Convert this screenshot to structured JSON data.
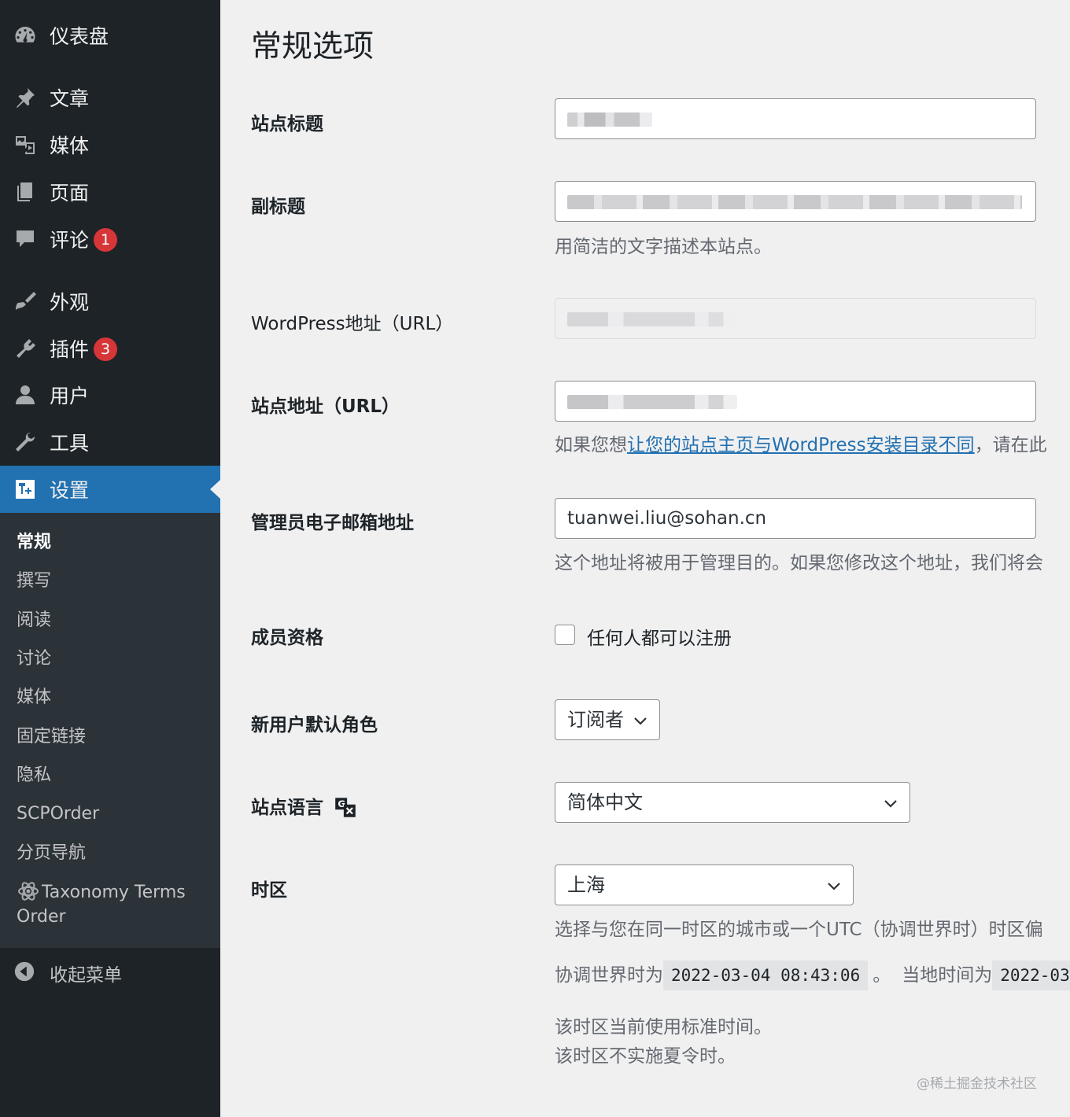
{
  "sidebar": {
    "items": [
      {
        "label": "仪表盘",
        "icon": "dashboard-icon"
      },
      {
        "label": "文章",
        "icon": "pin-icon"
      },
      {
        "label": "媒体",
        "icon": "media-icon"
      },
      {
        "label": "页面",
        "icon": "page-icon"
      },
      {
        "label": "评论",
        "icon": "comment-icon",
        "badge": "1"
      },
      {
        "label": "外观",
        "icon": "appearance-icon"
      },
      {
        "label": "插件",
        "icon": "plugin-icon",
        "badge": "3"
      },
      {
        "label": "用户",
        "icon": "users-icon"
      },
      {
        "label": "工具",
        "icon": "tools-icon"
      },
      {
        "label": "设置",
        "icon": "settings-icon",
        "active": true
      }
    ],
    "submenu": [
      {
        "label": "常规",
        "current": true
      },
      {
        "label": "撰写"
      },
      {
        "label": "阅读"
      },
      {
        "label": "讨论"
      },
      {
        "label": "媒体"
      },
      {
        "label": "固定链接"
      },
      {
        "label": "隐私"
      },
      {
        "label": "SCPOrder"
      },
      {
        "label": "分页导航"
      },
      {
        "label": "Taxonomy Terms Order",
        "icon": "atom-icon"
      }
    ],
    "collapse_label": "收起菜单"
  },
  "page": {
    "title": "常规选项",
    "site_title": {
      "label": "站点标题"
    },
    "tagline": {
      "label": "副标题",
      "description": "用简洁的文字描述本站点。"
    },
    "wp_url": {
      "label": "WordPress地址（URL）"
    },
    "site_url": {
      "label": "站点地址（URL）",
      "desc_prefix": "如果您想",
      "desc_link": "让您的站点主页与WordPress安装目录不同",
      "desc_suffix": "，请在此"
    },
    "admin_email": {
      "label": "管理员电子邮箱地址",
      "value": "tuanwei.liu@sohan.cn",
      "description": "这个地址将被用于管理目的。如果您修改这个地址，我们将会"
    },
    "membership": {
      "label": "成员资格",
      "checkbox_label": "任何人都可以注册",
      "checked": false
    },
    "default_role": {
      "label": "新用户默认角色",
      "value": "订阅者"
    },
    "site_language": {
      "label": "站点语言",
      "value": "简体中文",
      "icon": "translation-icon"
    },
    "timezone": {
      "label": "时区",
      "value": "上海",
      "description": "选择与您在同一时区的城市或一个UTC（协调世界时）时区偏",
      "utc_prefix": "协调世界时为",
      "utc_time": "2022-03-04 08:43:06",
      "utc_suffix": "。",
      "local_prefix": "当地时间为",
      "local_time": "2022-03",
      "std_time_note": "该时区当前使用标准时间。",
      "dst_note": "该时区不实施夏令时。"
    }
  },
  "watermark": "@稀土掘金技术社区",
  "colors": {
    "sidebar_bg": "#1d2327",
    "submenu_bg": "#2c3338",
    "accent": "#2271b1",
    "badge": "#d63638",
    "page_bg": "#f0f0f1"
  }
}
